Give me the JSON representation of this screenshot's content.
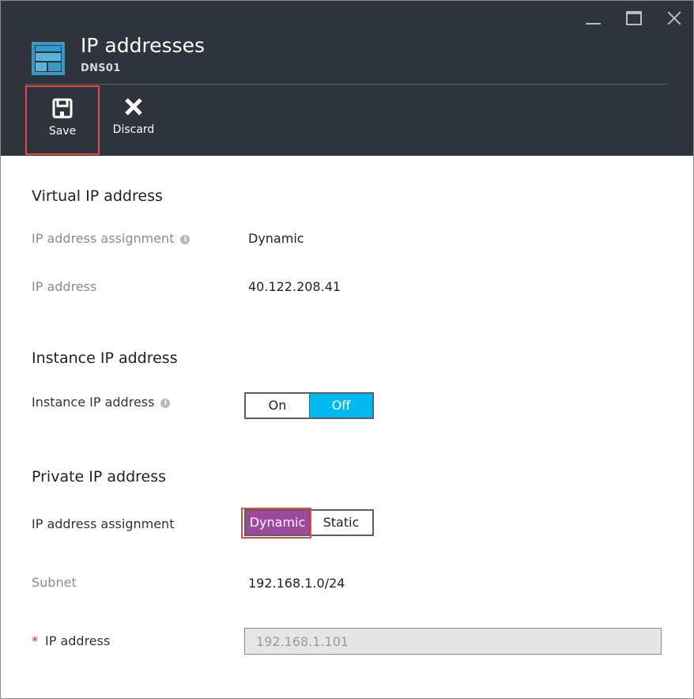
{
  "header": {
    "title": "IP addresses",
    "subtitle": "DNS01"
  },
  "commands": {
    "save_label": "Save",
    "discard_label": "Discard"
  },
  "virtual_ip": {
    "section_title": "Virtual IP address",
    "assignment_label": "IP address assignment",
    "assignment_value": "Dynamic",
    "ip_label": "IP address",
    "ip_value": "40.122.208.41"
  },
  "instance_ip": {
    "section_title": "Instance IP address",
    "label": "Instance IP address",
    "on_label": "On",
    "off_label": "Off",
    "selected": "Off"
  },
  "private_ip": {
    "section_title": "Private IP address",
    "assignment_label": "IP address assignment",
    "dynamic_label": "Dynamic",
    "static_label": "Static",
    "selected": "Dynamic",
    "subnet_label": "Subnet",
    "subnet_value": "192.168.1.0/24",
    "required_marker": "*",
    "ip_label": "IP address",
    "ip_value": "192.168.1.101"
  },
  "icons": {
    "info": "info-icon",
    "save": "save-icon",
    "discard": "discard-icon",
    "blade": "blade-layout-icon"
  },
  "colors": {
    "header_bg": "#2f333b",
    "toggle_selected_blue": "#00b9f1",
    "toggle_selected_purple": "#9e4a9c",
    "highlight_red": "#e04b43",
    "required_magenta": "#c5179a"
  }
}
